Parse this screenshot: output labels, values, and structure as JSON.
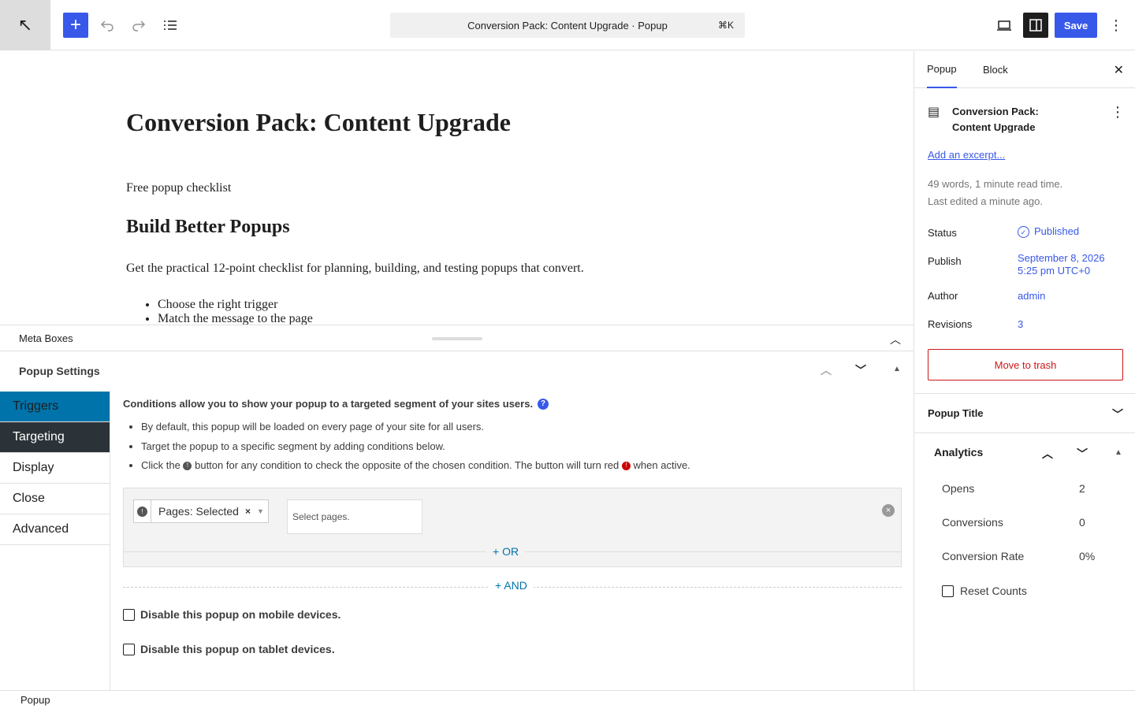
{
  "toolbar": {
    "back_icon": "↖",
    "add_icon": "+",
    "command_title": "Conversion Pack: Content Upgrade · Popup",
    "command_shortcut": "⌘K",
    "save_label": "Save",
    "more_icon": "⋮"
  },
  "editor": {
    "title": "Conversion Pack: Content Upgrade",
    "paragraph1": "Free popup checklist",
    "heading2": "Build Better Popups",
    "paragraph2": "Get the practical 12-point checklist for planning, building, and testing popups that convert.",
    "list": [
      "Choose the right trigger",
      "Match the message to the page"
    ]
  },
  "meta_boxes": {
    "label": "Meta Boxes",
    "collapse_icon": "︿"
  },
  "popup_settings": {
    "title": "Popup Settings",
    "up_icon": "︿",
    "down_icon": "﹀",
    "toggle_icon": "▲",
    "tabs": [
      "Triggers",
      "Targeting",
      "Display",
      "Close",
      "Advanced"
    ],
    "intro": "Conditions allow you to show your popup to a targeted segment of your sites users.",
    "help_icon": "?",
    "bullet1": "By default, this popup will be loaded on every page of your site for all users.",
    "bullet2": "Target the popup to a specific segment by adding conditions below.",
    "bullet3_part1": "Click the",
    "bullet3_part2": "button for any condition to check the opposite of the chosen condition. The button will turn red",
    "bullet3_part3": "when active.",
    "not_icon": "!",
    "condition_label": "Pages: Selected",
    "condition_clear": "×",
    "condition_arrow": "▼",
    "pages_placeholder": "Select pages.",
    "remove_icon": "×",
    "or_label": "+ OR",
    "and_label": "+ AND",
    "disable_mobile": "Disable this popup on mobile devices.",
    "disable_tablet": "Disable this popup on tablet devices."
  },
  "footer": {
    "breadcrumb": "Popup"
  },
  "sidebar": {
    "tab_popup": "Popup",
    "tab_block": "Block",
    "close_icon": "✕",
    "doc_icon": "▤",
    "doc_title": "Conversion Pack: Content Upgrade",
    "doc_more": "⋮",
    "excerpt_link": "Add an excerpt...",
    "stats_words": "49 words, 1 minute read time.",
    "stats_edited": "Last edited a minute ago.",
    "status_label": "Status",
    "status_value": "Published",
    "status_icon": "✓",
    "publish_label": "Publish",
    "publish_date": "September 8, 2026",
    "publish_time": "5:25 pm UTC+0",
    "author_label": "Author",
    "author_value": "admin",
    "revisions_label": "Revisions",
    "revisions_value": "3",
    "trash_label": "Move to trash",
    "popup_title_panel": "Popup Title",
    "chevron_down": "﹀",
    "analytics_title": "Analytics",
    "analytics_up": "︿",
    "analytics_down": "﹀",
    "analytics_toggle": "▲",
    "opens_label": "Opens",
    "opens_value": "2",
    "conversions_label": "Conversions",
    "conversions_value": "0",
    "rate_label": "Conversion Rate",
    "rate_value": "0%",
    "reset_label": "Reset Counts"
  },
  "colors": {
    "accent": "#3858e9",
    "wp_blue": "#0073aa",
    "danger": "#cc1818"
  }
}
